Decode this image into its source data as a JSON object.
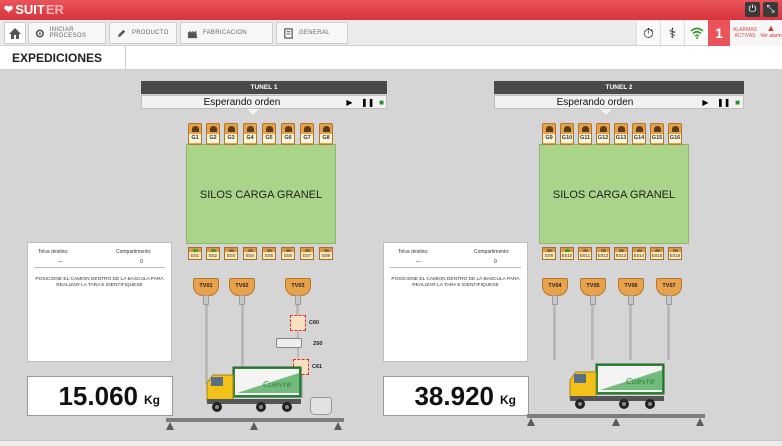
{
  "app": {
    "name_a": "SUIT",
    "name_b": "ER",
    "title": "EXPEDICIONES"
  },
  "toolbar": {
    "items": [
      {
        "label": "INICIAR PROCESOS",
        "icon": "settings-icon"
      },
      {
        "label": "PRODUCTO",
        "icon": "pencil-icon"
      },
      {
        "label": "FABRICACION",
        "icon": "factory-icon"
      },
      {
        "label": "GENERAL",
        "icon": "document-icon"
      }
    ]
  },
  "status": {
    "alarm_count": "1",
    "alarm_label_1": "ALARMAS",
    "alarm_label_2": "ACTIVAS",
    "ver_label": "Ver alarm"
  },
  "tunnels": [
    {
      "name": "TUNEL 1",
      "state": "Esperando orden",
      "silo_label": "SILOS CARGA GRANEL",
      "g_labels": [
        "G1",
        "G2",
        "G3",
        "G4",
        "G5",
        "G6",
        "G7",
        "G8"
      ],
      "e_labels": [
        "E01",
        "E02",
        "E03",
        "E04",
        "E05",
        "E06",
        "E07",
        "E08"
      ],
      "hoppers": [
        "TV01",
        "TV02",
        "TV03"
      ],
      "info": {
        "tolva_label": "Tolva destino:",
        "compart_label": "Compartimento:",
        "tolva_value": "---",
        "compart_value": "0",
        "message": "POSICIONE EL CAMION DENTRO DE LA BASCULA PARA REALIZAR LA TARA E IDENTIFIQUESE"
      },
      "weight": "15.060",
      "unit": "Kg",
      "sensors": [
        "C60",
        "Z60",
        "C61"
      ]
    },
    {
      "name": "TUNEL 2",
      "state": "Esperando orden",
      "silo_label": "SILOS CARGA GRANEL",
      "g_labels": [
        "G9",
        "G10",
        "G11",
        "G12",
        "G13",
        "G14",
        "G15",
        "G16"
      ],
      "e_labels": [
        "E09",
        "E010",
        "E011",
        "E012",
        "E013",
        "E014",
        "E015",
        "E016"
      ],
      "hoppers": [
        "TV04",
        "TV05",
        "TV06",
        "TV07"
      ],
      "info": {
        "tolva_label": "Tolva destino:",
        "compart_label": "Compartimento:",
        "tolva_value": "---",
        "compart_value": "0",
        "message": "POSICIONE EL CAMION DENTRO DE LA BASCULA PARA REALIZAR LA TARA E IDENTIFIQUESE"
      },
      "weight": "38.920",
      "unit": "Kg"
    }
  ],
  "truck_brand": "Cuevre",
  "colors": {
    "brand": "#d8343d",
    "silo": "#a9d48a",
    "tile": "#e7a14b",
    "active_led": "#3f9c32"
  }
}
